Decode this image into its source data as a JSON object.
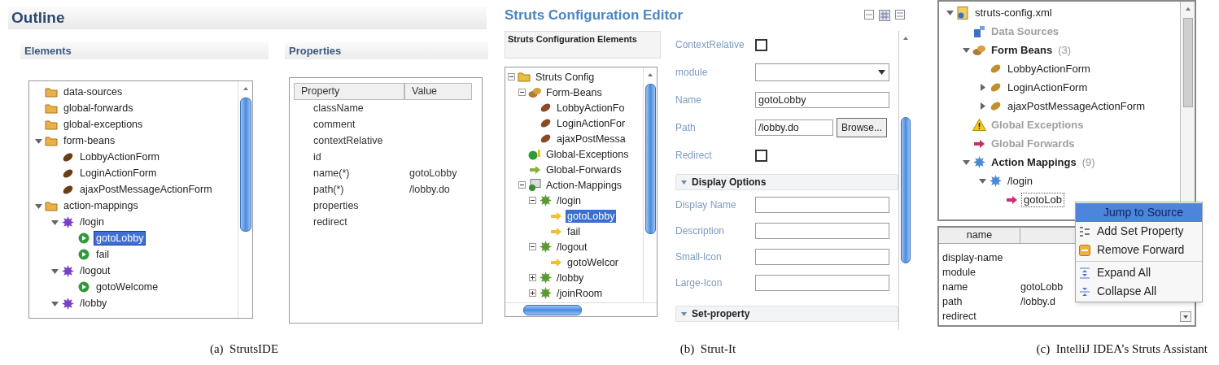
{
  "panel_a": {
    "title": "Outline",
    "elements_header": "Elements",
    "properties_header": "Properties",
    "tree": [
      {
        "label": "data-sources",
        "kind": "folder",
        "selected": false
      },
      {
        "label": "global-forwards",
        "kind": "folder",
        "selected": false
      },
      {
        "label": "global-exceptions",
        "kind": "folder",
        "selected": false
      },
      {
        "label": "form-beans",
        "kind": "folder",
        "selected": false,
        "expanded": true,
        "children": [
          {
            "label": "LobbyActionForm",
            "kind": "bean",
            "selected": false
          },
          {
            "label": "LoginActionForm",
            "kind": "bean",
            "selected": false
          },
          {
            "label": "ajaxPostMessageActionForm",
            "kind": "bean",
            "selected": false
          }
        ]
      },
      {
        "label": "action-mappings",
        "kind": "folder",
        "selected": false,
        "expanded": true,
        "children": [
          {
            "label": "/login",
            "kind": "action",
            "selected": false,
            "expanded": true,
            "children": [
              {
                "label": "gotoLobby",
                "kind": "forward",
                "selected": true
              },
              {
                "label": "fail",
                "kind": "forward",
                "selected": false
              }
            ]
          },
          {
            "label": "/logout",
            "kind": "action",
            "selected": false,
            "expanded": true,
            "children": [
              {
                "label": "gotoWelcome",
                "kind": "forward",
                "selected": false
              }
            ]
          },
          {
            "label": "/lobby",
            "kind": "action",
            "selected": false,
            "expanded": true
          }
        ]
      }
    ],
    "properties": {
      "columns": [
        "Property",
        "Value"
      ],
      "rows": [
        {
          "property": "className"
        },
        {
          "property": "comment"
        },
        {
          "property": "contextRelative"
        },
        {
          "property": "id"
        },
        {
          "property": "name(*)",
          "value": "gotoLobby"
        },
        {
          "property": "path(*)",
          "value": "/lobby.do"
        },
        {
          "property": "properties"
        },
        {
          "property": "redirect"
        }
      ]
    },
    "caption": "(a)  StrutsIDE"
  },
  "panel_b": {
    "title": "Struts Configuration Editor",
    "tree_header": "Struts Configuration Elements",
    "tree": [
      {
        "label": "Struts Config",
        "kind": "config",
        "selected": false,
        "expanded": true,
        "children": [
          {
            "label": "Form-Beans",
            "kind": "beans",
            "selected": false,
            "expanded": true,
            "children": [
              {
                "label": "LobbyActionFo",
                "kind": "bean",
                "selected": false
              },
              {
                "label": "LoginActionFor",
                "kind": "bean",
                "selected": false
              },
              {
                "label": "ajaxPostMessa",
                "kind": "bean",
                "selected": false
              }
            ]
          },
          {
            "label": "Global-Exceptions",
            "kind": "exceptions",
            "selected": false
          },
          {
            "label": "Global-Forwards",
            "kind": "forwards",
            "selected": false
          },
          {
            "label": "Action-Mappings",
            "kind": "mappings",
            "selected": false,
            "expanded": true,
            "children": [
              {
                "label": "/login",
                "kind": "action",
                "selected": false,
                "expanded": true,
                "children": [
                  {
                    "label": "gotoLobby",
                    "kind": "forward",
                    "selected": true
                  },
                  {
                    "label": "fail",
                    "kind": "forward",
                    "selected": false
                  }
                ]
              },
              {
                "label": "/logout",
                "kind": "action",
                "selected": false,
                "expanded": true,
                "children": [
                  {
                    "label": "gotoWelcor",
                    "kind": "forward",
                    "selected": false
                  }
                ]
              },
              {
                "label": "/lobby",
                "kind": "action",
                "selected": false,
                "expanded": false
              },
              {
                "label": "/joinRoom",
                "kind": "action",
                "selected": false,
                "expanded": false
              }
            ]
          }
        ]
      }
    ],
    "form": {
      "fields": [
        {
          "label": "ContextRelative",
          "kind": "checkbox",
          "checked": false
        },
        {
          "label": "module",
          "kind": "dropdown"
        },
        {
          "label": "Name",
          "kind": "text",
          "value": "gotoLobby"
        },
        {
          "label": "Path",
          "kind": "browse",
          "value": "/lobby.do",
          "button": "Browse..."
        },
        {
          "label": "Redirect",
          "kind": "checkbox",
          "checked": false
        }
      ],
      "sections": [
        {
          "title": "Display Options",
          "expanded": true,
          "fields": [
            {
              "label": "Display Name",
              "kind": "text"
            },
            {
              "label": "Description",
              "kind": "text"
            },
            {
              "label": "Small-Icon",
              "kind": "text"
            },
            {
              "label": "Large-Icon",
              "kind": "text"
            }
          ]
        },
        {
          "title": "Set-property",
          "expanded": true
        }
      ]
    },
    "caption": "(b)  Strut-It"
  },
  "panel_c": {
    "tree": [
      {
        "label": "struts-config.xml",
        "kind": "file",
        "selected": false,
        "expanded": true,
        "children": [
          {
            "label": "Data Sources",
            "kind": "datasource",
            "selected": false,
            "disabled": true
          },
          {
            "label": "Form Beans",
            "count": "(3)",
            "kind": "beans",
            "selected": false,
            "disabled": false,
            "expanded": true,
            "children": [
              {
                "label": "LobbyActionForm",
                "kind": "bean",
                "selected": false
              },
              {
                "label": "LoginActionForm",
                "kind": "bean",
                "selected": false,
                "expanded": false
              },
              {
                "label": "ajaxPostMessageActionForm",
                "kind": "bean",
                "selected": false,
                "expanded": false
              }
            ]
          },
          {
            "label": "Global Exceptions",
            "kind": "warning",
            "selected": false,
            "disabled": true
          },
          {
            "label": "Global Forwards",
            "kind": "forwards",
            "selected": false,
            "disabled": true
          },
          {
            "label": "Action Mappings",
            "count": "(9)",
            "kind": "mappings",
            "selected": false,
            "disabled": false,
            "expanded": true,
            "children": [
              {
                "label": "/login",
                "kind": "action",
                "selected": false,
                "expanded": true,
                "children": [
                  {
                    "label": "gotoLob",
                    "kind": "forward",
                    "selected": true
                  }
                ]
              }
            ]
          }
        ]
      }
    ],
    "properties": {
      "columns": [
        "name"
      ],
      "rows": [
        {
          "name": "display-name"
        },
        {
          "name": "module"
        },
        {
          "name": "name",
          "value": "gotoLobb"
        },
        {
          "name": "path",
          "value": "/lobby.d"
        },
        {
          "name": "redirect"
        }
      ]
    },
    "menu": [
      {
        "label": "Jump to Source",
        "kind": "jump",
        "selected": true
      },
      {
        "label": "Add Set Property",
        "kind": "property",
        "selected": false
      },
      {
        "label": "Remove Forward",
        "kind": "remove",
        "selected": false
      },
      {
        "kind": "separator"
      },
      {
        "label": "Expand All",
        "kind": "expand",
        "selected": false
      },
      {
        "label": "Collapse All",
        "kind": "collapse",
        "selected": false
      }
    ],
    "caption": "(c)  IntelliJ IDEA’s Struts Assistant"
  }
}
